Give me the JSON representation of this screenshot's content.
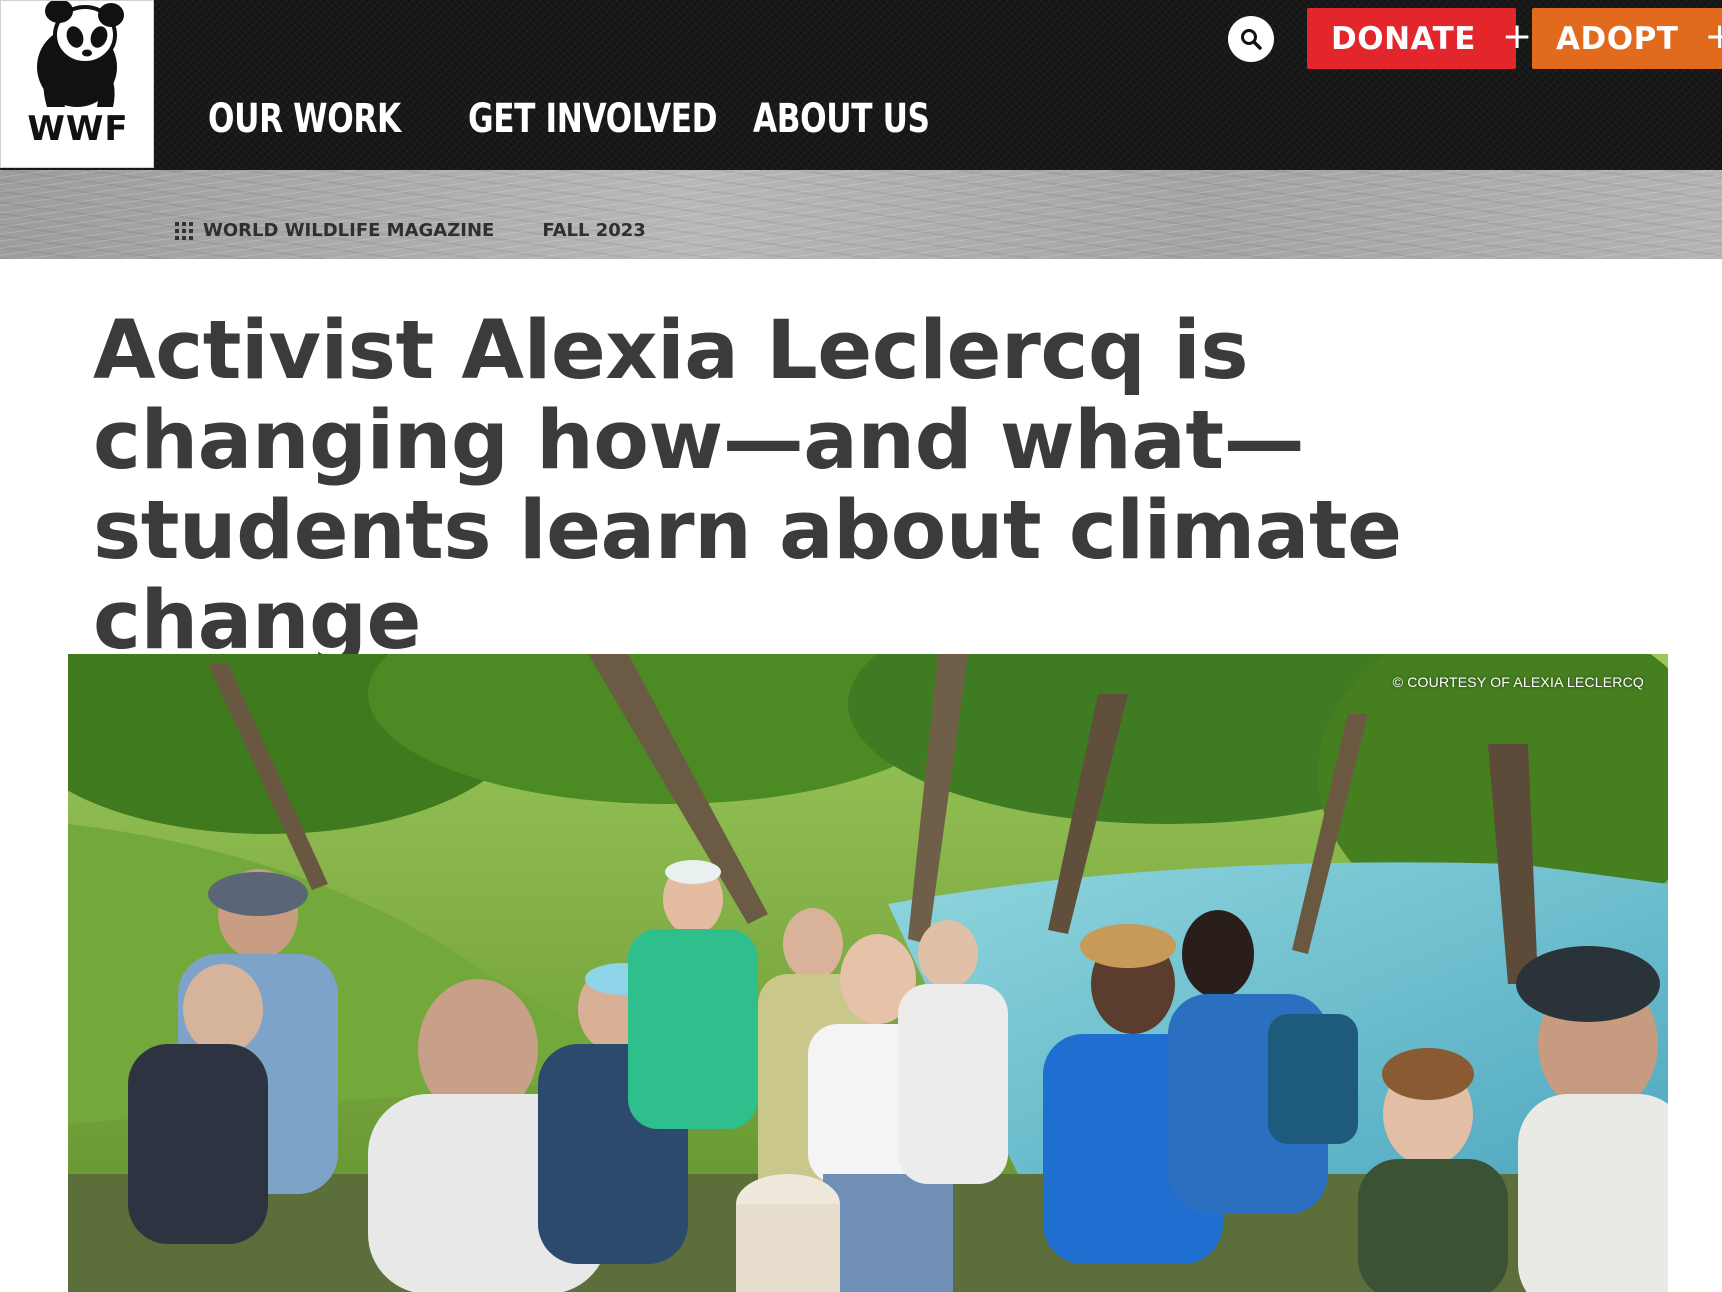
{
  "logo": {
    "text": "WWF"
  },
  "nav": {
    "items": [
      "OUR WORK",
      "GET INVOLVED",
      "ABOUT US"
    ]
  },
  "header_actions": {
    "donate_label": "DONATE",
    "adopt_label": "ADOPT",
    "plus": "+"
  },
  "breadcrumb": {
    "section": "WORLD WILDLIFE MAGAZINE",
    "issue": "FALL 2023"
  },
  "article": {
    "title": "Activist Alexia Leclercq is changing how—and what—students learn about climate change"
  },
  "photo": {
    "credit": "© COURTESY OF ALEXIA LECLERCQ"
  },
  "colors": {
    "donate": "#e2262b",
    "adopt": "#e26a1c",
    "header_bg": "#151515"
  }
}
